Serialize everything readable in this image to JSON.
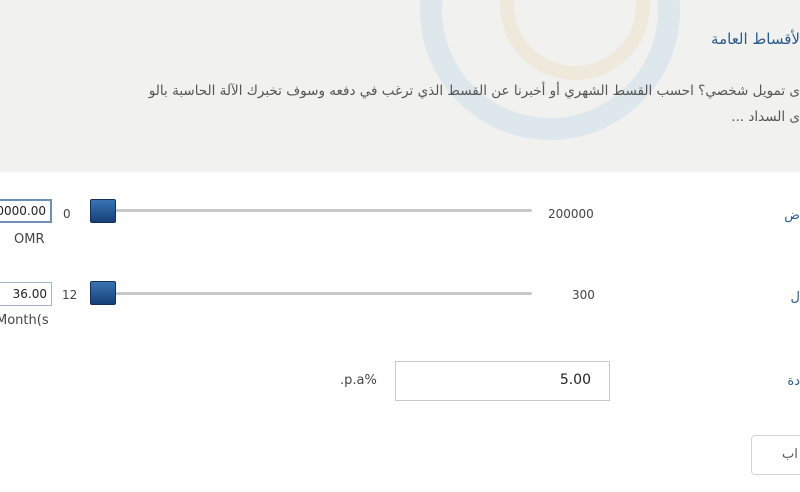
{
  "header": {
    "title": "لأقساط العامة",
    "description_line1": "ى تمويل شخصي؟ احسب القسط الشهري أو أخبرنا عن القسط الذي ترغب في دفعه وسوف تخبرك الآلة الحاسبة بالو",
    "description_line2": "ى السداد ..."
  },
  "loan_amount": {
    "label": "ض",
    "value": "0000.00",
    "unit": "OMR",
    "min": "0",
    "max": "200000",
    "slider_fraction": 0
  },
  "duration": {
    "label": "ل",
    "value": "36.00",
    "unit": "Month(s",
    "min": "12",
    "max": "300",
    "slider_fraction": 0
  },
  "interest_rate": {
    "label": "دة",
    "value": "5.00",
    "unit": ".p.a%"
  },
  "calculate_button": {
    "label": "اب"
  }
}
